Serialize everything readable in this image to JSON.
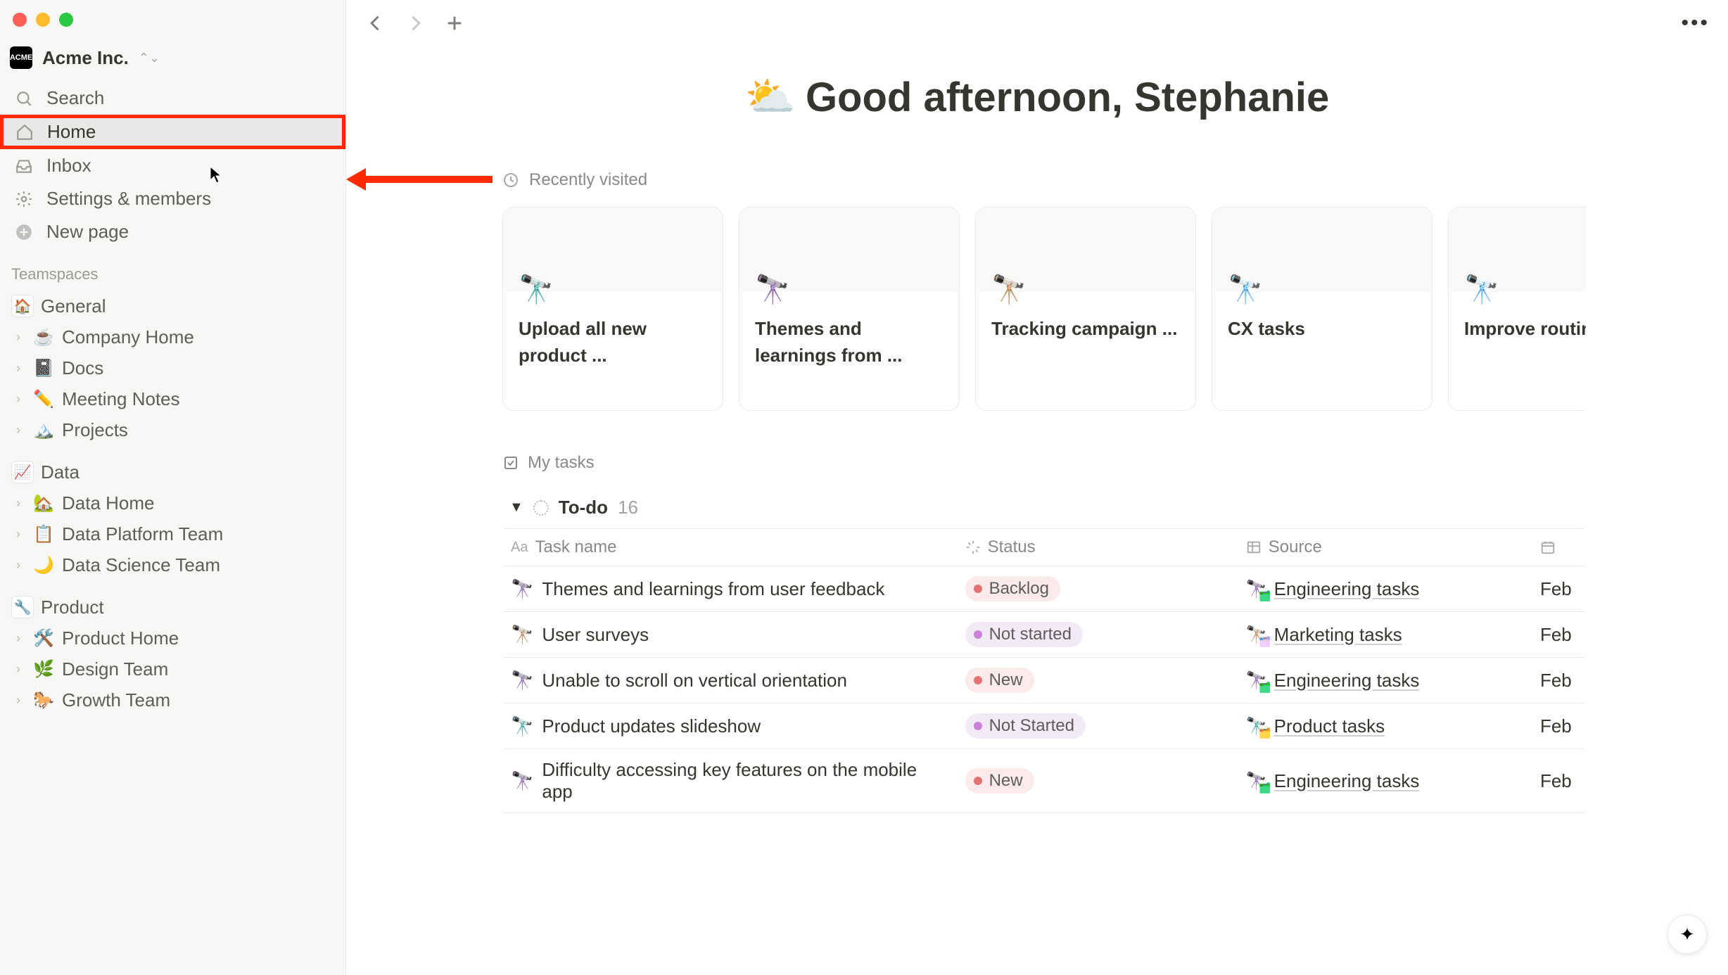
{
  "workspace": {
    "name": "Acme Inc.",
    "icon_label": "ACME"
  },
  "nav": {
    "search": "Search",
    "home": "Home",
    "inbox": "Inbox",
    "settings": "Settings & members",
    "new_page": "New page"
  },
  "teamspaces": {
    "header": "Teamspaces",
    "groups": [
      {
        "name": "General",
        "icon": "🏠",
        "children": [
          {
            "icon": "☕",
            "label": "Company Home"
          },
          {
            "icon": "📓",
            "label": "Docs"
          },
          {
            "icon": "✏️",
            "label": "Meeting Notes"
          },
          {
            "icon": "🏔️",
            "label": "Projects"
          }
        ]
      },
      {
        "name": "Data",
        "icon": "📈",
        "children": [
          {
            "icon": "🏡",
            "label": "Data Home"
          },
          {
            "icon": "📋",
            "label": "Data Platform Team"
          },
          {
            "icon": "🌙",
            "label": "Data Science Team"
          }
        ]
      },
      {
        "name": "Product",
        "icon": "🔧",
        "children": [
          {
            "icon": "🛠️",
            "label": "Product Home"
          },
          {
            "icon": "🌿",
            "label": "Design Team"
          },
          {
            "icon": "🐎",
            "label": "Growth Team"
          }
        ]
      }
    ]
  },
  "greeting": {
    "emoji": "⛅",
    "text": "Good afternoon, Stephanie"
  },
  "recently_visited": {
    "title": "Recently visited",
    "cards": [
      {
        "icon": "🔭",
        "icon_color": "red",
        "title": "Upload all new product ..."
      },
      {
        "icon": "🔭",
        "icon_color": "green",
        "title": "Themes and learnings from ..."
      },
      {
        "icon": "🔭",
        "icon_color": "purple",
        "title": "Tracking campaign ..."
      },
      {
        "icon": "🔭",
        "icon_color": "gold",
        "title": "CX tasks"
      },
      {
        "icon": "🔭",
        "icon_color": "gold",
        "title": "Improve routing logic"
      }
    ]
  },
  "my_tasks": {
    "title": "My tasks",
    "group": {
      "name": "To-do",
      "count": "16"
    },
    "columns": {
      "name": "Task name",
      "status": "Status",
      "source": "Source"
    },
    "rows": [
      {
        "icon": "🔭",
        "icon_color": "green",
        "name": "Themes and learnings from user feedback",
        "status_label": "Backlog",
        "status_class": "pill-backlog",
        "source_icon": "🔭",
        "source_icon_color": "green",
        "source": "Engineering tasks",
        "date": "Feb"
      },
      {
        "icon": "🔭",
        "icon_color": "purple",
        "name": "User surveys",
        "status_label": "Not started",
        "status_class": "pill-notstarted",
        "source_icon": "🔭",
        "source_icon_color": "purple",
        "source": "Marketing tasks",
        "date": "Feb"
      },
      {
        "icon": "🔭",
        "icon_color": "green",
        "name": "Unable to scroll on vertical orientation",
        "status_label": "New",
        "status_class": "pill-new",
        "source_icon": "🔭",
        "source_icon_color": "green",
        "source": "Engineering tasks",
        "date": "Feb"
      },
      {
        "icon": "🔭",
        "icon_color": "red",
        "name": "Product updates slideshow",
        "status_label": "Not Started",
        "status_class": "pill-notstarted",
        "source_icon": "🔭",
        "source_icon_color": "red",
        "source": "Product tasks",
        "date": "Feb"
      },
      {
        "icon": "🔭",
        "icon_color": "green",
        "name": "Difficulty accessing key features on the mobile app",
        "status_label": "New",
        "status_class": "pill-new",
        "source_icon": "🔭",
        "source_icon_color": "green",
        "source": "Engineering tasks",
        "date": "Feb"
      }
    ]
  }
}
